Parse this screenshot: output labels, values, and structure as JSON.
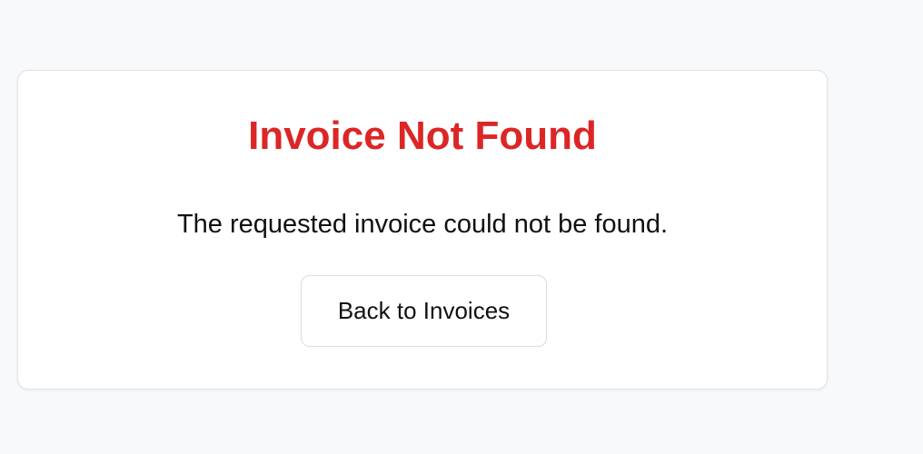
{
  "error_card": {
    "title": "Invoice Not Found",
    "message": "The requested invoice could not be found.",
    "back_button_label": "Back to Invoices"
  },
  "colors": {
    "page_background": "#f8f9fb",
    "title": "#dc2626",
    "card_background": "#ffffff",
    "border": "#e2e4e8"
  }
}
